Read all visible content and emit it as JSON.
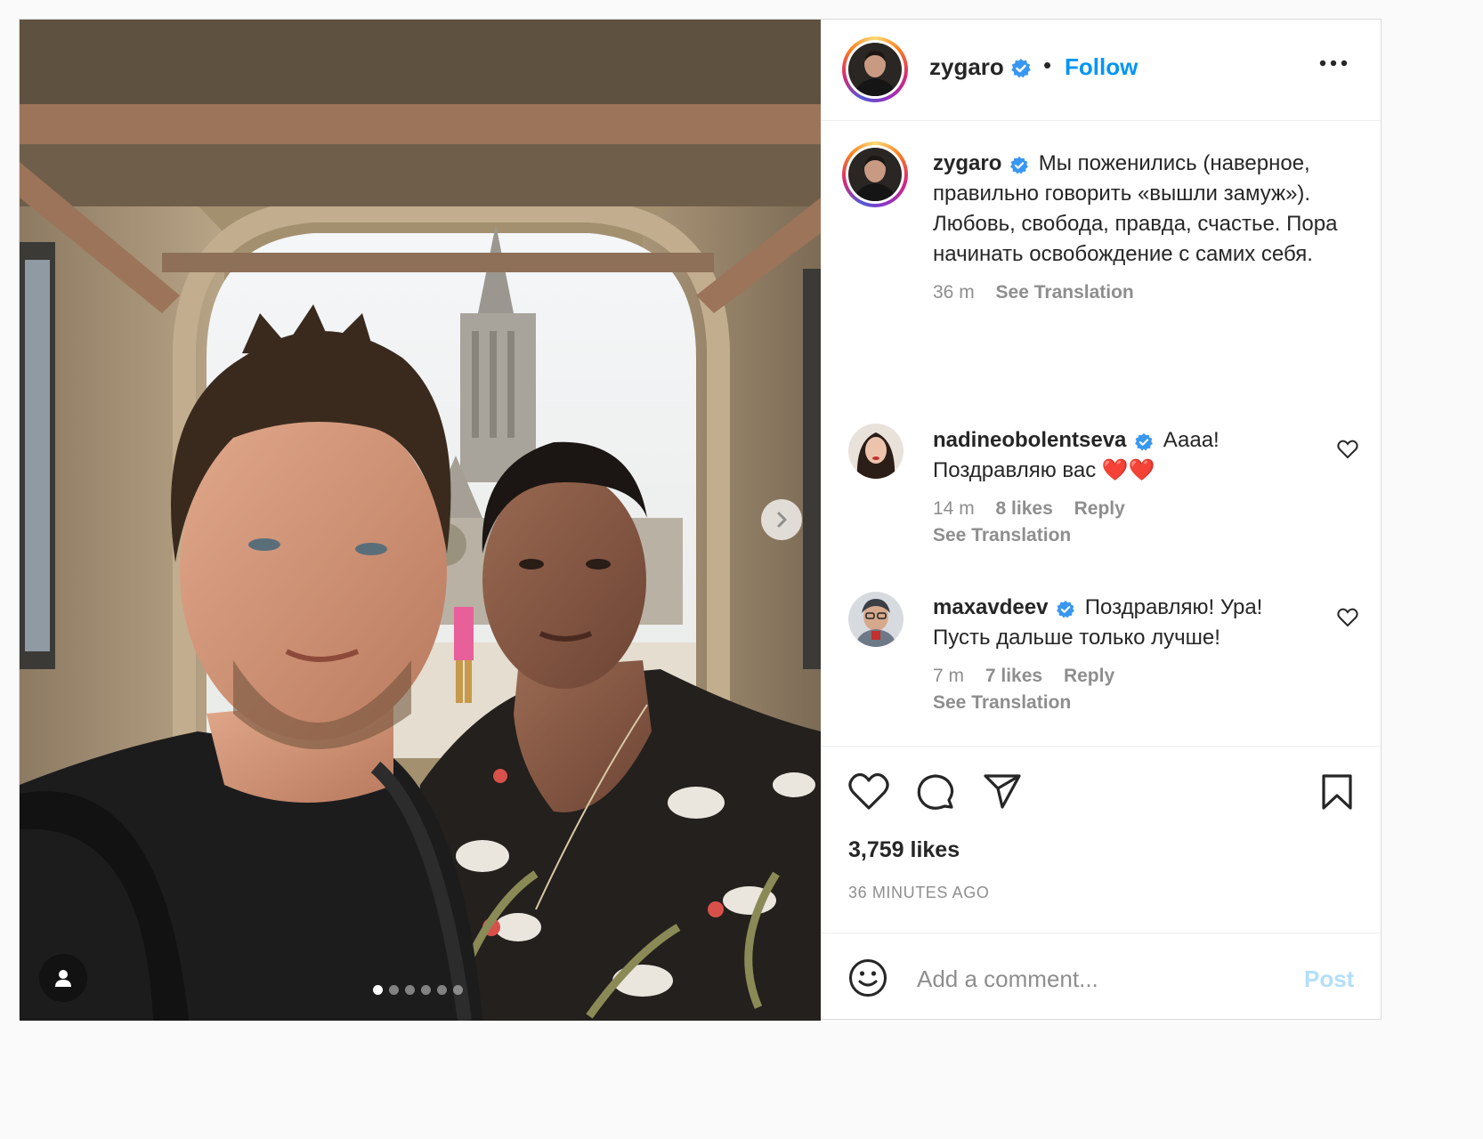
{
  "post": {
    "username": "zygaro",
    "follow_label": "Follow",
    "separator": "•",
    "caption": "Мы поженились (наверное, правильно говорить «вышли замуж»). Любовь, свобода, правда, счастье. Пора начинать освобождение с самих себя.",
    "caption_time": "36 m",
    "see_translation": "See Translation",
    "likes": "3,759 likes",
    "time_ago": "36 MINUTES AGO",
    "carousel": {
      "total": 6,
      "active": 1
    }
  },
  "comments": [
    {
      "username": "nadineobolentseva",
      "text": "Аааа! Поздравляю вас ❤️❤️",
      "time": "14 m",
      "likes": "8 likes",
      "reply": "Reply",
      "see_translation": "See Translation"
    },
    {
      "username": "maxavdeev",
      "text": "Поздравляю! Ура! Пусть дальше только лучше!",
      "time": "7 m",
      "likes": "7 likes",
      "reply": "Reply",
      "see_translation": "See Translation"
    }
  ],
  "add_comment": {
    "placeholder": "Add a comment...",
    "post_label": "Post"
  },
  "icons": {
    "verified": "verified-badge-icon",
    "more": "more-horizontal-icon",
    "like": "heart-icon",
    "comment": "comment-bubble-icon",
    "share": "paper-plane-icon",
    "save": "bookmark-icon",
    "emoji": "smiley-icon",
    "user_tags": "person-icon",
    "next": "chevron-right-icon"
  },
  "colors": {
    "accent": "#0095f6",
    "verified": "#3897f0",
    "muted": "#8e8e8e",
    "post_disabled": "#b2dffc"
  }
}
